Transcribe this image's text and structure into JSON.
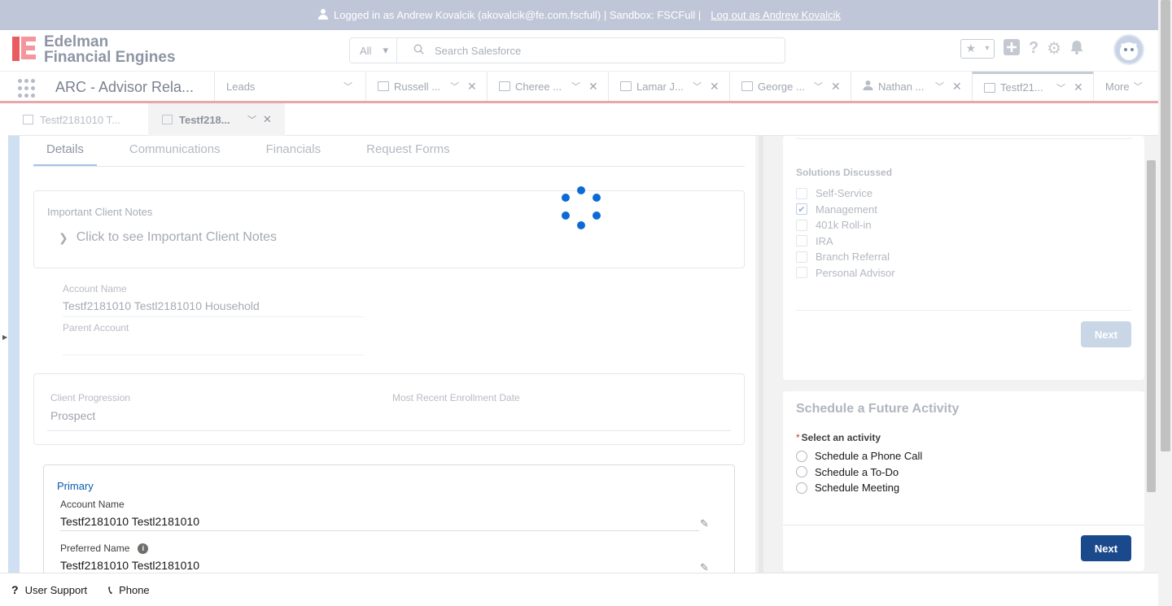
{
  "banner": {
    "text": "Logged in as Andrew Kovalcik (akovalcik@fe.com.fscfull) | Sandbox: FSCFull |",
    "logout": "Log out as Andrew Kovalcik"
  },
  "header": {
    "logo_line1": "Edelman",
    "logo_line2": "Financial Engines",
    "search_scope": "All",
    "search_placeholder": "Search Salesforce"
  },
  "nav": {
    "app_name": "ARC - Advisor Rela...",
    "tabs": [
      {
        "label": "Leads"
      },
      {
        "label": "Russell ..."
      },
      {
        "label": "Cheree ..."
      },
      {
        "label": "Lamar J..."
      },
      {
        "label": "George ..."
      },
      {
        "label": "Nathan ..."
      },
      {
        "label": "Testf21..."
      }
    ],
    "more": "More"
  },
  "subtabs": [
    {
      "label": "Testf2181010 T..."
    },
    {
      "label": "Testf218..."
    }
  ],
  "detail_tabs": [
    "Details",
    "Communications",
    "Financials",
    "Request Forms"
  ],
  "important_notes": {
    "title": "Important Client Notes",
    "link": "Click to see Important Client Notes"
  },
  "account": {
    "account_name_label": "Account Name",
    "account_name_value": "Testf2181010 Testl2181010 Household",
    "parent_label": "Parent Account",
    "parent_value": ""
  },
  "progression": {
    "client_progression_label": "Client Progression",
    "client_progression_value": "Prospect",
    "enrollment_label": "Most Recent Enrollment Date",
    "enrollment_value": ""
  },
  "primary": {
    "section": "Primary",
    "account_name_label": "Account Name",
    "account_name_value": "Testf2181010 Testl2181010",
    "preferred_label": "Preferred Name",
    "preferred_value": "Testf2181010 Testl2181010"
  },
  "solutions": {
    "title": "Solutions Discussed",
    "options": [
      {
        "label": "Self-Service",
        "checked": false
      },
      {
        "label": "Management",
        "checked": true
      },
      {
        "label": "401k Roll-in",
        "checked": false
      },
      {
        "label": "IRA",
        "checked": false
      },
      {
        "label": "Branch Referral",
        "checked": false
      },
      {
        "label": "Personal Advisor",
        "checked": false
      }
    ],
    "next": "Next"
  },
  "schedule": {
    "title": "Schedule a Future Activity",
    "required_mark": "*",
    "prompt": "Select an activity",
    "options": [
      "Schedule a Phone Call",
      "Schedule a To-Do",
      "Schedule Meeting"
    ],
    "next": "Next"
  },
  "footer": {
    "support": "User Support",
    "phone": "Phone"
  },
  "colors": {
    "brand_red": "#e3242b",
    "primary_button": "#1b4a8c",
    "disabled_button": "#c9d6e6",
    "spinner": "#0c6ad7"
  }
}
